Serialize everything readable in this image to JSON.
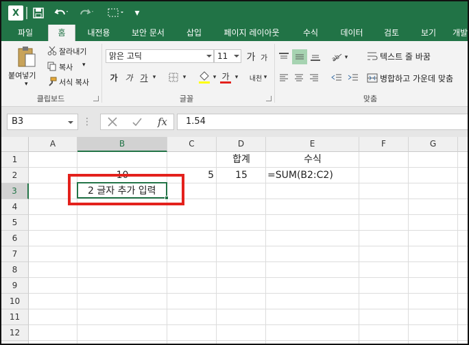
{
  "qat": {
    "app_icon": "excel-icon",
    "customize": "▾"
  },
  "tabs": [
    "파일",
    "홈",
    "내전용",
    "보안 문서",
    "삽입",
    "페이지 레이아웃",
    "수식",
    "데이터",
    "검토",
    "보기",
    "개발"
  ],
  "ribbon": {
    "clipboard": {
      "paste": "붙여넣기",
      "cut": "잘라내기",
      "copy": "복사",
      "format_painter": "서식 복사",
      "label": "클립보드"
    },
    "font": {
      "name": "맑은 고딕",
      "size": "11",
      "grow": "가",
      "shrink": "가",
      "bold": "가",
      "italic": "가",
      "underline": "가",
      "font_color": "가",
      "phonetic": "내천",
      "label": "글꼴"
    },
    "alignment": {
      "wrap": "텍스트 줄 바꿈",
      "merge": "병합하고 가운데 맞춤",
      "label": "맞춤"
    }
  },
  "formula_bar": {
    "name_box": "B3",
    "fx": "fx",
    "value": "1.54"
  },
  "grid": {
    "columns": [
      "A",
      "B",
      "C",
      "D",
      "E",
      "F",
      "G"
    ],
    "rows": [
      "1",
      "2",
      "3",
      "4",
      "5",
      "6",
      "7",
      "8",
      "9",
      "10",
      "11",
      "12",
      "13"
    ],
    "selected_column": "B",
    "selected_row": "3",
    "cells": {
      "D1": "합계",
      "E1": "수식",
      "B2": "10",
      "C2": "5",
      "D2": "15",
      "E2": "=SUM(B2:C2)",
      "B3": "2 글자 추가 입력"
    }
  }
}
